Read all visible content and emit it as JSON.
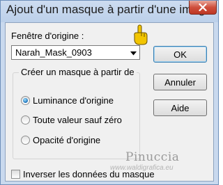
{
  "window": {
    "title": "Ajout d'un masque à partir d'une image"
  },
  "source": {
    "label": "Fenêtre d'origine :",
    "selected": "Narah_Mask_0903"
  },
  "buttons": {
    "ok": "OK",
    "cancel": "Annuler",
    "help": "Aide"
  },
  "mask_group": {
    "label": "Créer un masque à partir de",
    "options": [
      {
        "label": "Luminance d'origine",
        "checked": true
      },
      {
        "label": "Toute valeur sauf zéro",
        "checked": false
      },
      {
        "label": "Opacité d'origine",
        "checked": false
      }
    ]
  },
  "invert": {
    "label": "Inverser les données du masque",
    "checked": false
  },
  "watermark": {
    "name": "Pinuccia",
    "url": "www.waldigrafica.eu"
  },
  "colors": {
    "titlebar": "#c9d9ee",
    "close": "#c9493a",
    "dialog_bg": "#f0f0f0",
    "radio_selected": "#1b70b8"
  }
}
